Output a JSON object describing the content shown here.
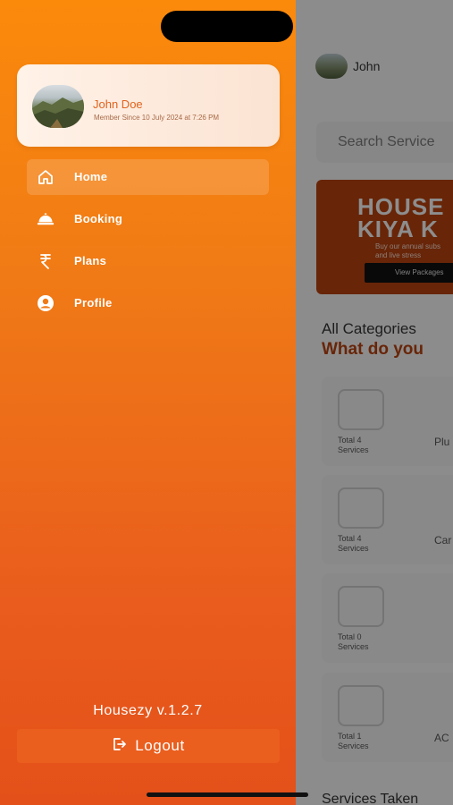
{
  "background": {
    "username": "John",
    "search_placeholder": "Search Service",
    "banner": {
      "title": "HOUSE\nKIYA K",
      "subtitle": "Buy our annual subs\nand live stress",
      "button": "View Packages"
    },
    "categories_title": "All Categories",
    "categories_subtitle": "What do you",
    "cards": [
      {
        "count": "Total 4 Services",
        "name": "Plu"
      },
      {
        "count": "Total 4 Services",
        "name": "Car"
      },
      {
        "count": "Total 0 Services",
        "name": ""
      },
      {
        "count": "Total 1 Services",
        "name": "AC"
      }
    ],
    "services_taken": "Services Taken"
  },
  "drawer": {
    "profile": {
      "name": "John Doe",
      "member_since": "Member Since 10 July 2024 at 7:26 PM"
    },
    "menu": [
      {
        "label": "Home",
        "icon": "home-icon",
        "active": true
      },
      {
        "label": "Booking",
        "icon": "service-bell-icon",
        "active": false
      },
      {
        "label": "Plans",
        "icon": "rupee-icon",
        "active": false
      },
      {
        "label": "Profile",
        "icon": "user-circle-icon",
        "active": false
      }
    ],
    "version": "Housezy  v.1.2.7",
    "logout_label": "Logout"
  },
  "colors": {
    "drawer_top": "#fb8a0b",
    "drawer_bottom": "#e45019",
    "accent": "#e1631d"
  }
}
